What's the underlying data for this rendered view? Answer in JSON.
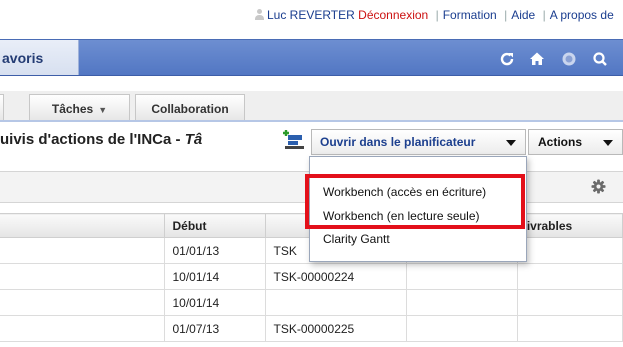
{
  "top_links": {
    "user": "Luc REVERTER",
    "logout": "Déconnexion",
    "training": "Formation",
    "help": "Aide",
    "about": "A propos de",
    "separator": "|"
  },
  "header": {
    "favorites_label": "avoris",
    "icons": [
      "refresh-icon",
      "home-icon",
      "record-icon",
      "search-icon"
    ]
  },
  "tabs": [
    {
      "label": ""
    },
    {
      "label": "Tâches",
      "caret": "▼"
    },
    {
      "label": "Collaboration"
    }
  ],
  "page": {
    "title": "uivis d'actions de l'INCa - ",
    "title_italic": "Tâ"
  },
  "toolbar": {
    "planner_label": "Ouvrir dans le planificateur",
    "actions_label": "Actions"
  },
  "menu": {
    "items": [
      "Workbench (accès en écriture)",
      "Workbench (en lecture seule)",
      "Clarity Gantt"
    ],
    "highlight_color": "#e3101a"
  },
  "grid": {
    "columns": [
      "",
      "Début",
      "",
      "",
      "Livrables"
    ],
    "rows": [
      [
        "",
        "01/01/13",
        "TSK",
        "",
        ""
      ],
      [
        "",
        "10/01/14",
        "TSK-00000224",
        "",
        ""
      ],
      [
        "",
        "10/01/14",
        "",
        "",
        ""
      ],
      [
        "",
        "01/07/13",
        "TSK-00000225",
        "",
        ""
      ]
    ]
  },
  "colors": {
    "header_blue": "#5277c3",
    "link_blue": "#1a3d8f",
    "logout_red": "#cc1111"
  }
}
